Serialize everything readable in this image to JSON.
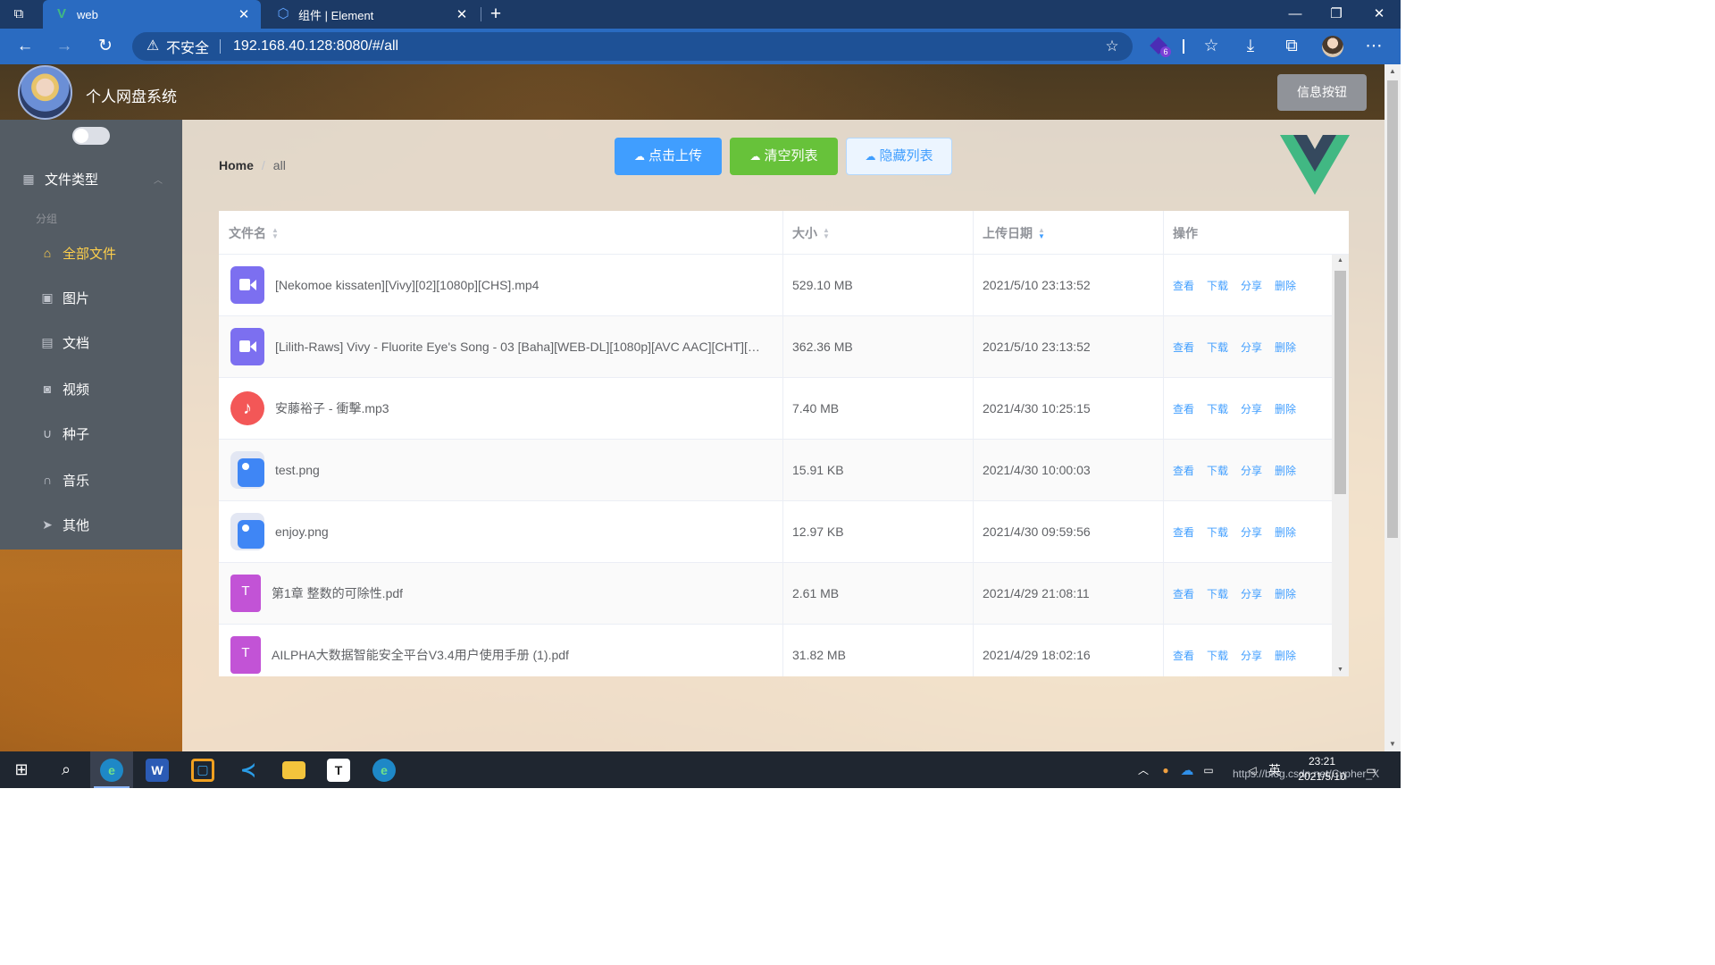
{
  "browser": {
    "tabs": [
      {
        "title": "web",
        "favicon": "vue-logo-icon",
        "close": "✕"
      },
      {
        "title": "组件 | Element",
        "favicon": "element-logo-icon",
        "close": "✕"
      }
    ],
    "new_tab": "+",
    "address": {
      "security_label": "不安全",
      "url": "192.168.40.128:8080/#/all"
    },
    "extension_badge": "6"
  },
  "header": {
    "title": "个人网盘系统",
    "info_button": "信息按钮"
  },
  "sidebar": {
    "submenu_title": "文件类型",
    "group_title": "分组",
    "items": [
      {
        "label": "全部文件",
        "icon": "home-icon",
        "active": true
      },
      {
        "label": "图片",
        "icon": "picture-icon",
        "active": false
      },
      {
        "label": "文档",
        "icon": "document-icon",
        "active": false
      },
      {
        "label": "视频",
        "icon": "camera-icon",
        "active": false
      },
      {
        "label": "种子",
        "icon": "magnet-icon",
        "active": false
      },
      {
        "label": "音乐",
        "icon": "headset-icon",
        "active": false
      },
      {
        "label": "其他",
        "icon": "send-icon",
        "active": false
      }
    ]
  },
  "breadcrumb": {
    "home": "Home",
    "separator": "/",
    "current": "all"
  },
  "toolbar": {
    "upload": "点击上传",
    "clear": "清空列表",
    "hide": "隐藏列表"
  },
  "table": {
    "columns": {
      "name": "文件名",
      "size": "大小",
      "date": "上传日期",
      "ops": "操作"
    },
    "actions": {
      "view": "查看",
      "download": "下载",
      "share": "分享",
      "delete": "删除"
    },
    "rows": [
      {
        "name": "[Nekomoe kissaten][Vivy][02][1080p][CHS].mp4",
        "type": "video",
        "size": "529.10 MB",
        "date": "2021/5/10 23:13:52"
      },
      {
        "name": "[Lilith-Raws] Vivy - Fluorite Eye's Song - 03 [Baha][WEB-DL][1080p][AVC AAC][CHT][…",
        "type": "video",
        "size": "362.36 MB",
        "date": "2021/5/10 23:13:52"
      },
      {
        "name": "安藤裕子 - 衝擊.mp3",
        "type": "audio",
        "size": "7.40 MB",
        "date": "2021/4/30 10:25:15"
      },
      {
        "name": "test.png",
        "type": "image",
        "size": "15.91 KB",
        "date": "2021/4/30 10:00:03"
      },
      {
        "name": "enjoy.png",
        "type": "image",
        "size": "12.97 KB",
        "date": "2021/4/30 09:59:56"
      },
      {
        "name": "第1章 整数的可除性.pdf",
        "type": "pdf",
        "size": "2.61 MB",
        "date": "2021/4/29 21:08:11"
      },
      {
        "name": "AILPHA大数据智能安全平台V3.4用户使用手册 (1).pdf",
        "type": "pdf",
        "size": "31.82 MB",
        "date": "2021/4/29 18:02:16"
      }
    ]
  },
  "taskbar": {
    "time": "23:21",
    "date": "2021/5/10",
    "ime": "英",
    "watermark": "https://blog.csdn.net/Cypher_X"
  },
  "colors": {
    "primary": "#409eff",
    "success": "#67c23a",
    "info": "#909399",
    "menu_bg": "#545c64",
    "menu_active": "#ffd04b",
    "browser_blue": "#2a6bc1"
  }
}
